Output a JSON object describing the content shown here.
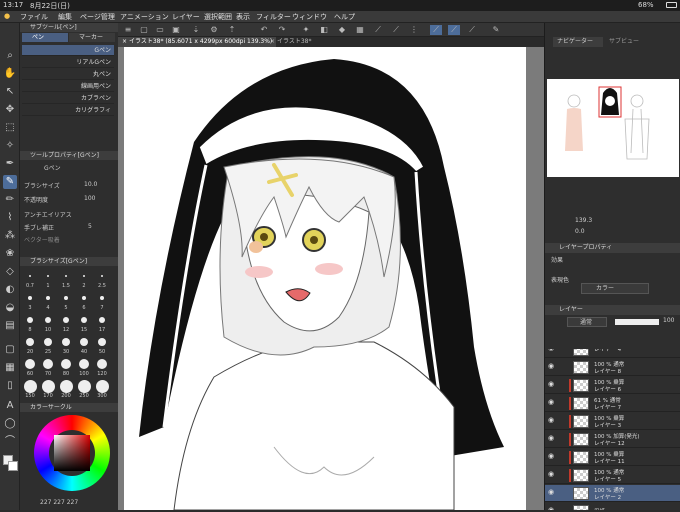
{
  "status": {
    "time": "13:17",
    "date": "8月22日(日)",
    "battery": "68%"
  },
  "menu": [
    "ファイル",
    "編集",
    "ページ管理",
    "アニメーション",
    "レイヤー",
    "選択範囲",
    "表示",
    "フィルター",
    "ウィンドウ",
    "ヘルプ"
  ],
  "tabs": [
    {
      "label": "イラスト38* (85.6071 x 4299px 600dpi 139.3%)"
    },
    {
      "label": "イラスト38*"
    }
  ],
  "left": {
    "subtool_header": "サブツール[ペン]",
    "tab_pen": "ペン",
    "tab_marker": "マーカー",
    "brushes": [
      "Gペン",
      "リアルGペン",
      "丸ペン",
      "線画用ペン",
      "カブラペン",
      "カリグラフィ"
    ],
    "toolprop_header": "ツールプロパティ[Gペン]",
    "toolprop_label": "Gペン",
    "props": [
      {
        "label": "ブラシサイズ",
        "value": "10.0"
      },
      {
        "label": "不透明度",
        "value": "100"
      },
      {
        "label": "アンチエイリアス",
        "value": ""
      },
      {
        "label": "手ブレ補正",
        "value": "5"
      },
      {
        "label": "ベクター吸着",
        "value": ""
      }
    ],
    "brushsize_header": "ブラシサイズ[Gペン]",
    "sizes": [
      "0.7",
      "1",
      "1.5",
      "2",
      "2.5",
      "3",
      "4",
      "5",
      "6",
      "7",
      "8",
      "10",
      "12",
      "15",
      "17",
      "20",
      "25",
      "30",
      "40",
      "50",
      "60",
      "70",
      "80",
      "100",
      "120",
      "150",
      "170",
      "200",
      "250",
      "300"
    ],
    "color_header": "カラーサークル",
    "color_values": "227 227 227"
  },
  "right": {
    "navigator_tab": "ナビゲーター",
    "subview_tab": "サブビュー",
    "zoom": "139.3",
    "rotate": "0.0",
    "layerprop_header": "レイヤープロパティ",
    "effect_label": "効果",
    "express_label": "表現色",
    "express_value": "カラー",
    "layer_header": "レイヤー",
    "blend_mode": "通常",
    "opacity": "100",
    "layers": [
      {
        "pct": "",
        "mode": "",
        "name": "レイヤー 4",
        "clip": false,
        "sel": false
      },
      {
        "pct": "100 %",
        "mode": "通常",
        "name": "レイヤー 8",
        "clip": false,
        "sel": false
      },
      {
        "pct": "100 %",
        "mode": "乗算",
        "name": "レイヤー 6",
        "clip": true,
        "sel": false
      },
      {
        "pct": "61 %",
        "mode": "通常",
        "name": "レイヤー 7",
        "clip": true,
        "sel": false
      },
      {
        "pct": "100 %",
        "mode": "乗算",
        "name": "レイヤー 3",
        "clip": true,
        "sel": false
      },
      {
        "pct": "100 %",
        "mode": "加算(発光)",
        "name": "レイヤー 12",
        "clip": true,
        "sel": false
      },
      {
        "pct": "100 %",
        "mode": "乗算",
        "name": "レイヤー 11",
        "clip": true,
        "sel": false
      },
      {
        "pct": "100 %",
        "mode": "通常",
        "name": "レイヤー 5",
        "clip": true,
        "sel": false
      },
      {
        "pct": "100 %",
        "mode": "通常",
        "name": "レイヤー 2",
        "clip": false,
        "sel": true
      },
      {
        "pct": "",
        "mode": "",
        "name": "用紙",
        "clip": false,
        "sel": false
      }
    ]
  }
}
